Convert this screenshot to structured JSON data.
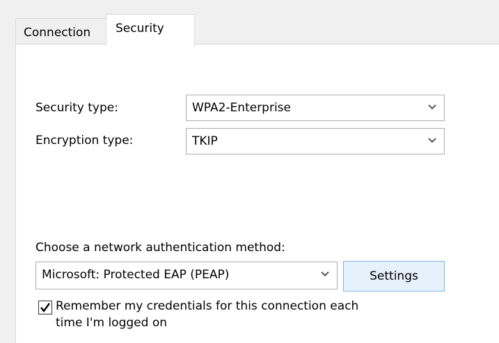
{
  "tabs": [
    {
      "label": "Connection"
    },
    {
      "label": "Security"
    }
  ],
  "security_type": {
    "label": "Security type:",
    "value": "WPA2-Enterprise"
  },
  "encryption_type": {
    "label": "Encryption type:",
    "value": "TKIP"
  },
  "auth": {
    "label": "Choose a network authentication method:",
    "value": "Microsoft: Protected EAP (PEAP)",
    "settings_label": "Settings"
  },
  "remember": {
    "checked": true,
    "text": "Remember my credentials for this connection each time I'm logged on"
  },
  "icons": {
    "dropdown": "chevron-down-icon",
    "check": "checkmark-icon"
  }
}
